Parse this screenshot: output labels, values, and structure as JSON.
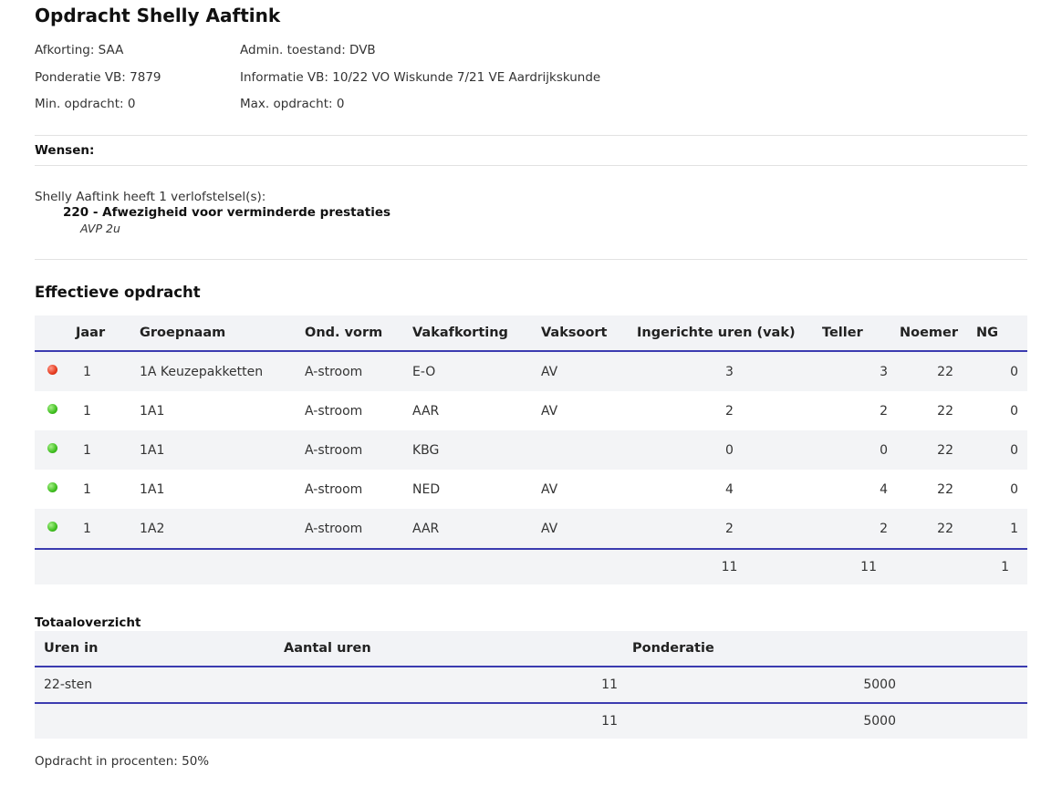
{
  "page": {
    "title": "Opdracht Shelly Aaftink"
  },
  "info": {
    "afkorting": "Afkorting: SAA",
    "admin": "Admin. toestand: DVB",
    "ponderatie": "Ponderatie VB: 7879",
    "informatie": "Informatie VB: 10/22 VO Wiskunde 7/21 VE Aardrijkskunde",
    "min": "Min. opdracht: 0",
    "max": "Max. opdracht: 0"
  },
  "wensen": {
    "label": "Wensen:"
  },
  "verlof": {
    "intro": "Shelly Aaftink heeft 1 verlofstelsel(s):",
    "code": "220 - Afwezigheid voor verminderde prestaties",
    "detail": "AVP 2u"
  },
  "effectief": {
    "heading": "Effectieve opdracht",
    "columns": [
      "Jaar",
      "Groepnaam",
      "Ond. vorm",
      "Vakafkorting",
      "Vaksoort",
      "Ingerichte uren (vak)",
      "Teller",
      "Noemer",
      "NG"
    ],
    "rows": [
      {
        "status": "red",
        "jaar": "1",
        "groep": "1A Keuzepakketten",
        "vorm": "A-stroom",
        "vak": "E-O",
        "soort": "AV",
        "uren": "3",
        "teller": "3",
        "noemer": "22",
        "ng": "0"
      },
      {
        "status": "green",
        "jaar": "1",
        "groep": "1A1",
        "vorm": "A-stroom",
        "vak": "AAR",
        "soort": "AV",
        "uren": "2",
        "teller": "2",
        "noemer": "22",
        "ng": "0"
      },
      {
        "status": "green",
        "jaar": "1",
        "groep": "1A1",
        "vorm": "A-stroom",
        "vak": "KBG",
        "soort": "",
        "uren": "0",
        "teller": "0",
        "noemer": "22",
        "ng": "0"
      },
      {
        "status": "green",
        "jaar": "1",
        "groep": "1A1",
        "vorm": "A-stroom",
        "vak": "NED",
        "soort": "AV",
        "uren": "4",
        "teller": "4",
        "noemer": "22",
        "ng": "0"
      },
      {
        "status": "green",
        "jaar": "1",
        "groep": "1A2",
        "vorm": "A-stroom",
        "vak": "AAR",
        "soort": "AV",
        "uren": "2",
        "teller": "2",
        "noemer": "22",
        "ng": "1"
      }
    ],
    "totals": {
      "uren": "11",
      "teller": "11",
      "ng": "1"
    }
  },
  "totaal": {
    "label": "Totaaloverzicht",
    "columns": [
      "Uren in",
      "Aantal uren",
      "Ponderatie"
    ],
    "row": {
      "uren_in": "22-sten",
      "aantal": "11",
      "ponderatie": "5000"
    },
    "totals": {
      "aantal": "11",
      "ponderatie": "5000"
    }
  },
  "procent": "Opdracht in procenten: 50%",
  "colors": {
    "accent_line": "#3b3bb0",
    "link": "#2233cc",
    "status_red": "#e53b1f",
    "status_green": "#3fbf1f"
  }
}
